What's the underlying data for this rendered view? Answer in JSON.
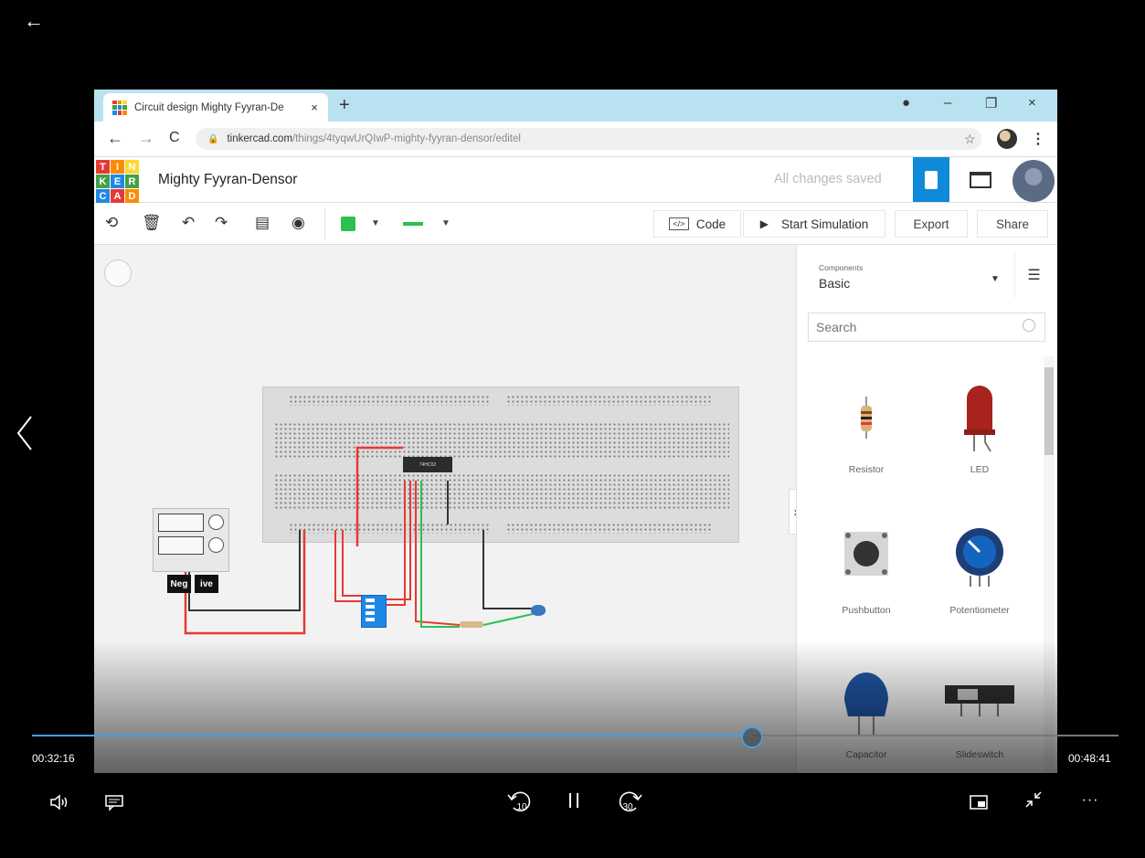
{
  "browser": {
    "tab_title": "Circuit design Mighty Fyyran-De",
    "tab_close": "×",
    "new_tab": "+",
    "win_record": "●",
    "win_minimize": "–",
    "win_restore": "❐",
    "win_close": "×",
    "url_host": "tinkercad.com",
    "url_path": "/things/4tyqwUrQIwP-mighty-fyyran-densor/editel"
  },
  "tinkercad": {
    "logo_letters": [
      "T",
      "I",
      "N",
      "K",
      "E",
      "R",
      "C",
      "A",
      "D"
    ],
    "logo_colors": [
      "#e53935",
      "#fb8c00",
      "#fdd835",
      "#43a047",
      "#1e88e5",
      "#43a047",
      "#1e88e5",
      "#e53935",
      "#fb8c00"
    ],
    "doc_title": "Mighty Fyyran-Densor",
    "saved_status": "All changes saved"
  },
  "toolbar": {
    "code_label": "Code",
    "code_icon": "</>",
    "simulation_label": "Start Simulation",
    "export_label": "Export",
    "share_label": "Share",
    "wire_color": "#2ec04e"
  },
  "canvas": {
    "chip_label": "74HC02",
    "tooltip_left": "Neg",
    "tooltip_right": "ive"
  },
  "components_panel": {
    "category_label": "Components",
    "category_value": "Basic",
    "search_placeholder": "Search",
    "items": [
      {
        "label": "Resistor"
      },
      {
        "label": "LED"
      },
      {
        "label": "Pushbutton"
      },
      {
        "label": "Potentiometer"
      },
      {
        "label": "Capacitor"
      },
      {
        "label": "Slideswitch"
      }
    ]
  },
  "player": {
    "current_time": "00:32:16",
    "total_time": "00:48:41",
    "progress": 0.663,
    "skip_back_label": "10",
    "skip_forward_label": "30",
    "more_label": "···"
  }
}
